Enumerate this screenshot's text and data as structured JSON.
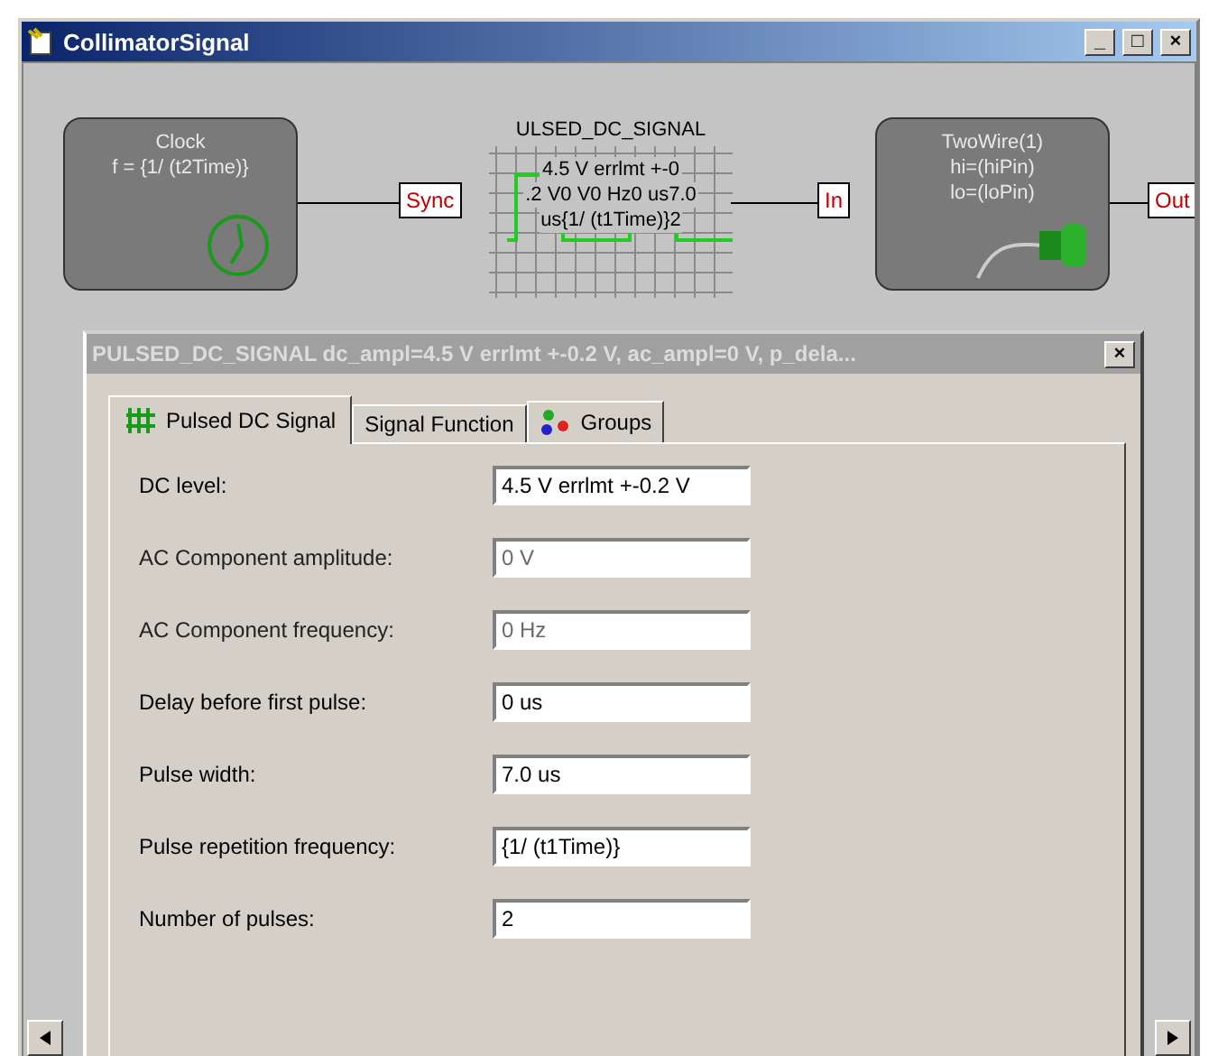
{
  "window": {
    "title": "CollimatorSignal",
    "controls": [
      "_",
      "□",
      "×"
    ]
  },
  "diagram": {
    "nodes": [
      {
        "kind": "clock",
        "lines": [
          "Clock",
          "f = {1/ (t2Time)}"
        ]
      },
      {
        "kind": "signal",
        "lines": [
          "ULSED_DC_SIGNAL",
          "4.5 V errlmt +-0",
          ".2 V0 V0 Hz0 us7.0",
          "us{1/ (t1Time)}2"
        ]
      },
      {
        "kind": "twowire",
        "lines": [
          "TwoWire(1)",
          "hi=(hiPin)",
          "lo=(loPin)"
        ]
      }
    ],
    "ports": [
      "Sync",
      "In",
      "Out"
    ]
  },
  "dialog": {
    "title": "PULSED_DC_SIGNAL dc_ampl=4.5 V errlmt +-0.2 V, ac_ampl=0 V, p_dela...",
    "close": "×",
    "tabs": [
      {
        "label": "Pulsed DC Signal",
        "selected": true
      },
      {
        "label": "Signal Function",
        "selected": false
      },
      {
        "label": "Groups",
        "selected": false
      }
    ],
    "fields": [
      {
        "label": "DC level:",
        "value": "4.5 V errlmt +-0.2 V",
        "disabled": false
      },
      {
        "label": "AC Component amplitude:",
        "value": "0 V",
        "disabled": true
      },
      {
        "label": "AC Component frequency:",
        "value": "0 Hz",
        "disabled": true
      },
      {
        "label": "Delay before first pulse:",
        "value": "0 us",
        "disabled": false
      },
      {
        "label": "Pulse width:",
        "value": "7.0 us",
        "disabled": false
      },
      {
        "label": "Pulse repetition frequency:",
        "value": "{1/ (t1Time)}",
        "disabled": false
      },
      {
        "label": "Number of pulses:",
        "value": "2",
        "disabled": false
      }
    ]
  }
}
